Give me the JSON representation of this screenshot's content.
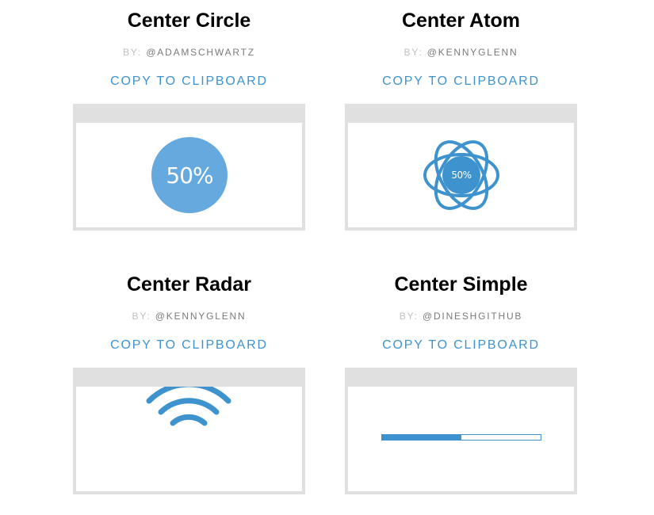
{
  "cards": [
    {
      "title": "Center Circle",
      "by_label": "BY:",
      "author": "@ADAMSCHWARTZ",
      "copy_label": "COPY TO CLIPBOARD",
      "progress_text": "50%",
      "progress": 0.5
    },
    {
      "title": "Center Atom",
      "by_label": "BY:",
      "author": "@KENNYGLENN",
      "copy_label": "COPY TO CLIPBOARD",
      "progress_text": "50%",
      "progress": 0.5
    },
    {
      "title": "Center Radar",
      "by_label": "BY:",
      "author": "@KENNYGLENN",
      "copy_label": "COPY TO CLIPBOARD"
    },
    {
      "title": "Center Simple",
      "by_label": "BY:",
      "author": "@DINESHGITHUB",
      "copy_label": "COPY TO CLIPBOARD",
      "progress": 0.5
    }
  ],
  "colors": {
    "accent": "#3e93cf",
    "circle_fill": "#65a9df",
    "frame": "#e0e0e0"
  }
}
